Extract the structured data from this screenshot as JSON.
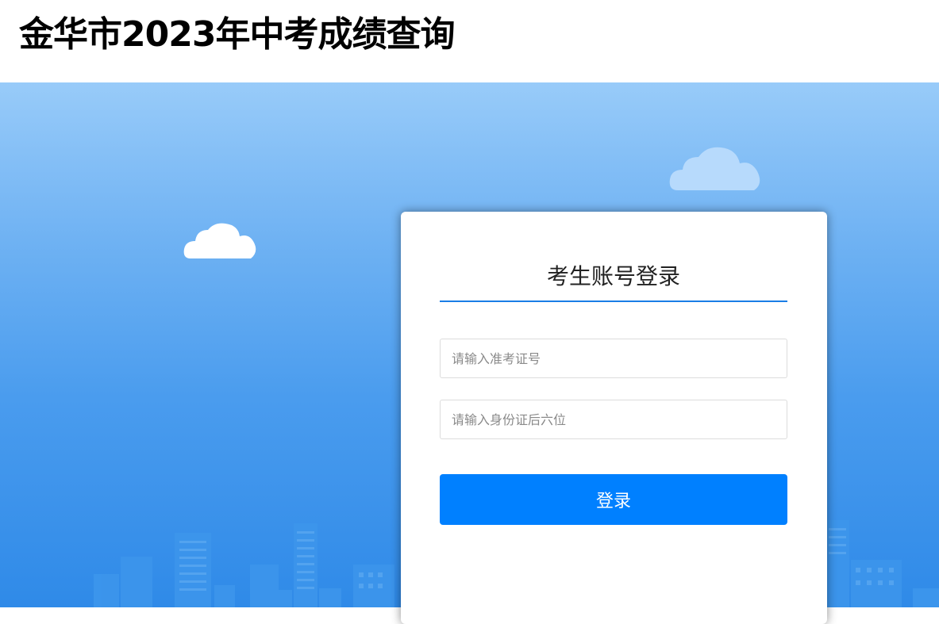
{
  "header": {
    "title": "金华市2023年中考成绩查询"
  },
  "login": {
    "title": "考生账号登录",
    "exam_number": {
      "value": "",
      "placeholder": "请输入准考证号"
    },
    "id_suffix": {
      "value": "",
      "placeholder": "请输入身份证后六位"
    },
    "submit_label": "登录"
  },
  "colors": {
    "accent": "#0080ff",
    "underline": "#1a7ee6",
    "sky_top": "#98cbf9",
    "sky_bottom": "#2f8ae8"
  }
}
